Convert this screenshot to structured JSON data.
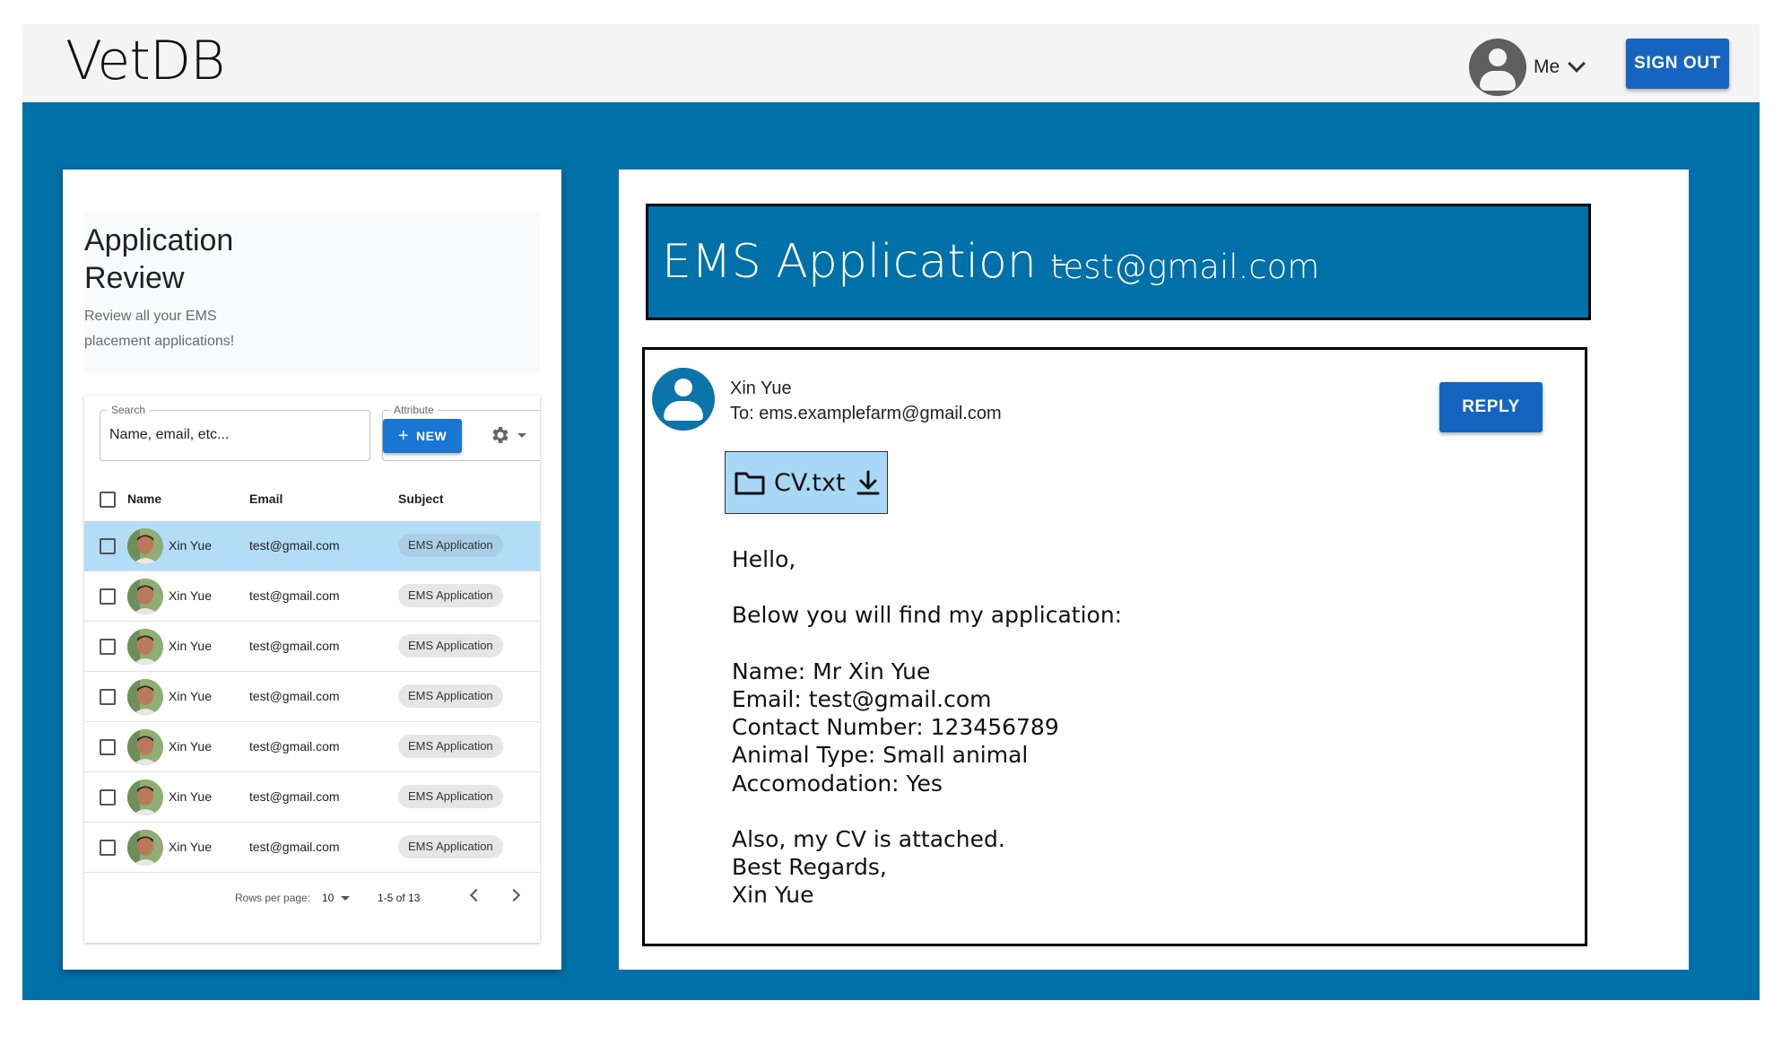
{
  "app": {
    "brand": "VetDB",
    "user_menu_label": "Me",
    "sign_out_label": "SIGN OUT"
  },
  "intro": {
    "title": "Application Review",
    "subtitle": "Review all your EMS placement applications!"
  },
  "toolbar": {
    "search_legend": "Search",
    "search_placeholder": "Name, email, etc...",
    "attribute_legend": "Attribute",
    "new_label": "NEW"
  },
  "table": {
    "columns": [
      "Name",
      "Email",
      "Subject"
    ],
    "rows": [
      {
        "name": "Xin Yue",
        "email": "test@gmail.com",
        "subject": "EMS Application",
        "selected": true
      },
      {
        "name": "Xin Yue",
        "email": "test@gmail.com",
        "subject": "EMS Application",
        "selected": false
      },
      {
        "name": "Xin Yue",
        "email": "test@gmail.com",
        "subject": "EMS Application",
        "selected": false
      },
      {
        "name": "Xin Yue",
        "email": "test@gmail.com",
        "subject": "EMS Application",
        "selected": false
      },
      {
        "name": "Xin Yue",
        "email": "test@gmail.com",
        "subject": "EMS Application",
        "selected": false
      },
      {
        "name": "Xin Yue",
        "email": "test@gmail.com",
        "subject": "EMS Application",
        "selected": false
      },
      {
        "name": "Xin Yue",
        "email": "test@gmail.com",
        "subject": "EMS Application",
        "selected": false
      }
    ],
    "pagination": {
      "rows_per_page_label": "Rows per page:",
      "rows_per_page_value": "10",
      "range": "1-5 of 13"
    }
  },
  "message": {
    "header_title": "EMS Application -",
    "header_email": "test@gmail.com",
    "sender_name": "Xin Yue",
    "recipient": "To: ems.examplefarm@gmail.com",
    "reply_label": "REPLY",
    "attachment_name": "CV.txt",
    "body_lines": [
      "Hello,",
      "",
      "Below you will find my application:",
      "",
      "Name: Mr Xin Yue",
      "Email: test@gmail.com",
      "Contact Number: 123456789",
      "Animal Type: Small animal",
      "Accomodation: Yes",
      "",
      "Also, my CV is attached.",
      "Best Regards,",
      "Xin Yue"
    ]
  },
  "icons": {
    "user_avatar": "account-circle-icon",
    "user_menu_chevron": "chevron-down-icon",
    "new_button": "plus-icon",
    "column_settings": "gear-icon",
    "row_avatar": "person-photo-avatar",
    "attachment": "folder-icon",
    "download": "download-icon",
    "pager_prev": "chevron-left-icon",
    "pager_next": "chevron-right-icon"
  },
  "colors": {
    "primary_blue": "#0070a8",
    "button_blue": "#1565c0",
    "selected_row": "#b3dcf7",
    "attachment_bg": "#a8d8f6"
  }
}
